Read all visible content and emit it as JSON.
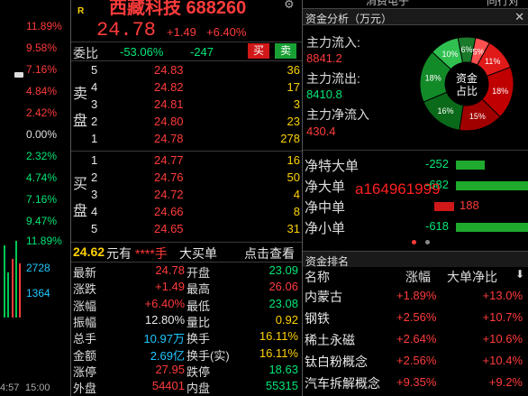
{
  "left_axis": {
    "labels": [
      "11.89%",
      "9.58%",
      "7.16%",
      "4.84%",
      "2.42%",
      "0.00%",
      "2.32%",
      "4.74%",
      "7.16%",
      "9.47%",
      "11.89%"
    ],
    "colors": [
      "#ff3b3b",
      "#ff3b3b",
      "#ff3b3b",
      "#ff3b3b",
      "#ff3b3b",
      "#e0e0e0",
      "#00e676",
      "#00e676",
      "#00e676",
      "#00e676",
      "#00e676"
    ],
    "volume_labels": [
      "2728",
      "1364"
    ],
    "time_labels": [
      "4:57",
      "15:00"
    ]
  },
  "quote": {
    "flag": "R",
    "title": "西藏科技 688260",
    "price": "24.78",
    "change": "+1.49",
    "change_pct": "+6.40%",
    "weibi_label": "委比",
    "weibi_pct": "-53.06%",
    "weibi_diff": "-247",
    "buy_btn": "买",
    "sell_btn": "卖"
  },
  "sell_side_label": [
    "卖",
    "盘"
  ],
  "buy_side_label": [
    "买",
    "盘"
  ],
  "asks": [
    {
      "level": "5",
      "price": "24.83",
      "vol": "36"
    },
    {
      "level": "4",
      "price": "24.82",
      "vol": "17"
    },
    {
      "level": "3",
      "price": "24.81",
      "vol": "3"
    },
    {
      "level": "2",
      "price": "24.80",
      "vol": "23"
    },
    {
      "level": "1",
      "price": "24.78",
      "vol": "278"
    }
  ],
  "bids": [
    {
      "level": "1",
      "price": "24.77",
      "vol": "16"
    },
    {
      "level": "2",
      "price": "24.76",
      "vol": "50"
    },
    {
      "level": "3",
      "price": "24.72",
      "vol": "4"
    },
    {
      "level": "4",
      "price": "24.66",
      "vol": "8"
    },
    {
      "level": "5",
      "price": "24.65",
      "vol": "31"
    }
  ],
  "big_order": {
    "price": "24.62",
    "unit": "元有",
    "masked": "****手",
    "label": "大买单",
    "link": "点击查看"
  },
  "stats": [
    {
      "l1": "最新",
      "v1": "24.78",
      "l2": "开盘",
      "v2": "23.09",
      "c1": "#ff3b3b",
      "c2": "#00e676"
    },
    {
      "l1": "涨跌",
      "v1": "+1.49",
      "l2": "最高",
      "v2": "26.06",
      "c1": "#ff3b3b",
      "c2": "#ff3b3b"
    },
    {
      "l1": "涨幅",
      "v1": "+6.40%",
      "l2": "最低",
      "v2": "23.08",
      "c1": "#ff3b3b",
      "c2": "#00e676"
    },
    {
      "l1": "振幅",
      "v1": "12.80%",
      "l2": "量比",
      "v2": "0.92",
      "c1": "#e8e8e8",
      "c2": "#ffd200"
    },
    {
      "l1": "总手",
      "v1": "10.97万",
      "l2": "换手",
      "v2": "16.11%",
      "c1": "#1ec8ff",
      "c2": "#ffd200"
    },
    {
      "l1": "金额",
      "v1": "2.69亿",
      "l2": "换手(实)",
      "v2": "16.11%",
      "c1": "#1ec8ff",
      "c2": "#ffd200"
    },
    {
      "l1": "涨停",
      "v1": "27.95",
      "l2": "跌停",
      "v2": "18.63",
      "c1": "#ff3b3b",
      "c2": "#00e676"
    },
    {
      "l1": "外盘",
      "v1": "54401",
      "l2": "内盘",
      "v2": "55315",
      "c1": "#ff3b3b",
      "c2": "#00e676"
    }
  ],
  "top_strip": {
    "text1": "消费电子",
    "text2": "同行对"
  },
  "capital": {
    "header": "资金分析（万元）",
    "inflow_label": "主力流入:",
    "inflow": "8841.2",
    "outflow_label": "主力流出:",
    "outflow": "8410.8",
    "net_label": "主力净流入",
    "net": "430.4",
    "donut_center": [
      "资金",
      "占比"
    ],
    "donut": [
      {
        "label": "6%",
        "value": 6,
        "color": "#1a7a2a"
      },
      {
        "label": "5%",
        "value": 5,
        "color": "#ff5050"
      },
      {
        "label": "11%",
        "value": 11,
        "color": "#e01919"
      },
      {
        "label": "18%",
        "value": 18,
        "color": "#c00000"
      },
      {
        "label": "15%",
        "value": 15,
        "color": "#a00000"
      },
      {
        "label": "16%",
        "value": 16,
        "color": "#0a6a1a"
      },
      {
        "label": "18%",
        "value": 18,
        "color": "#128a28"
      },
      {
        "label": "10%",
        "value": 10,
        "color": "#30c050"
      }
    ]
  },
  "flows": [
    {
      "label": "净特大单",
      "value": "-252",
      "bar": 32,
      "color": "#1faa2e"
    },
    {
      "label": "净大单",
      "value": "-682",
      "bar": 80,
      "color": "#1faa2e"
    },
    {
      "label": "净中单",
      "value": "188",
      "bar": 22,
      "color": "#d01818"
    },
    {
      "label": "净小单",
      "value": "-618",
      "bar": 86,
      "color": "#1faa2e"
    }
  ],
  "watermark": "a164961999",
  "ranking": {
    "header": "资金排名",
    "cols": [
      "名称",
      "涨幅",
      "大单净比"
    ],
    "rows": [
      {
        "name": "内蒙古",
        "pct": "+1.89%",
        "net": "+13.0%"
      },
      {
        "name": "钢铁",
        "pct": "+2.56%",
        "net": "+10.7%"
      },
      {
        "name": "稀土永磁",
        "pct": "+2.64%",
        "net": "+10.6%"
      },
      {
        "name": "钛白粉概念",
        "pct": "+2.56%",
        "net": "+10.4%"
      },
      {
        "name": "汽车拆解概念",
        "pct": "+9.35%",
        "net": "+9.2%"
      }
    ]
  }
}
